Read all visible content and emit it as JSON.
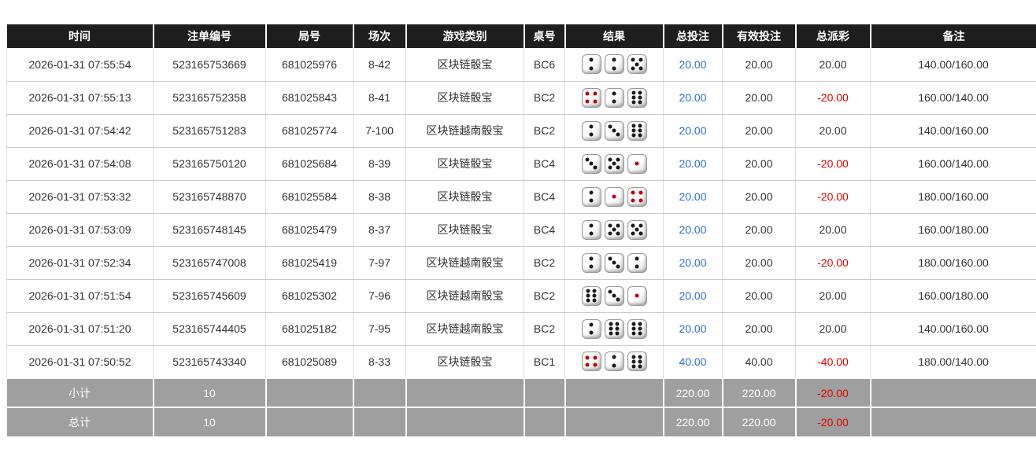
{
  "colors": {
    "header_bg": "#1e1e1e",
    "footer_bg": "#9f9f9f",
    "bet_link_blue": "#2a6ed8",
    "negative_red": "#e00000"
  },
  "table": {
    "headers": [
      "时间",
      "注单编号",
      "局号",
      "场次",
      "游戏类别",
      "桌号",
      "结果",
      "总投注",
      "有效投注",
      "总派彩",
      "备注"
    ],
    "rows": [
      {
        "time": "2026-01-31 07:55:54",
        "bet_id": "523165753669",
        "round_id": "681025976",
        "session": "8-42",
        "game": "区块链骰宝",
        "table_no": "BC6",
        "dice": [
          2,
          2,
          5
        ],
        "total_bet": "20.00",
        "valid_bet": "20.00",
        "payout": "20.00",
        "remark": "140.00/160.00"
      },
      {
        "time": "2026-01-31 07:55:13",
        "bet_id": "523165752358",
        "round_id": "681025843",
        "session": "8-41",
        "game": "区块链骰宝",
        "table_no": "BC2",
        "dice": [
          4,
          2,
          6
        ],
        "total_bet": "20.00",
        "valid_bet": "20.00",
        "payout": "-20.00",
        "remark": "160.00/140.00"
      },
      {
        "time": "2026-01-31 07:54:42",
        "bet_id": "523165751283",
        "round_id": "681025774",
        "session": "7-100",
        "game": "区块链越南骰宝",
        "table_no": "BC2",
        "dice": [
          2,
          3,
          6
        ],
        "total_bet": "20.00",
        "valid_bet": "20.00",
        "payout": "20.00",
        "remark": "140.00/160.00"
      },
      {
        "time": "2026-01-31 07:54:08",
        "bet_id": "523165750120",
        "round_id": "681025684",
        "session": "8-39",
        "game": "区块链骰宝",
        "table_no": "BC4",
        "dice": [
          3,
          5,
          1
        ],
        "total_bet": "20.00",
        "valid_bet": "20.00",
        "payout": "-20.00",
        "remark": "160.00/140.00"
      },
      {
        "time": "2026-01-31 07:53:32",
        "bet_id": "523165748870",
        "round_id": "681025584",
        "session": "8-38",
        "game": "区块链骰宝",
        "table_no": "BC4",
        "dice": [
          2,
          1,
          4
        ],
        "total_bet": "20.00",
        "valid_bet": "20.00",
        "payout": "-20.00",
        "remark": "180.00/160.00"
      },
      {
        "time": "2026-01-31 07:53:09",
        "bet_id": "523165748145",
        "round_id": "681025479",
        "session": "8-37",
        "game": "区块链骰宝",
        "table_no": "BC4",
        "dice": [
          2,
          5,
          5
        ],
        "total_bet": "20.00",
        "valid_bet": "20.00",
        "payout": "20.00",
        "remark": "160.00/180.00"
      },
      {
        "time": "2026-01-31 07:52:34",
        "bet_id": "523165747008",
        "round_id": "681025419",
        "session": "7-97",
        "game": "区块链越南骰宝",
        "table_no": "BC2",
        "dice": [
          2,
          3,
          2
        ],
        "total_bet": "20.00",
        "valid_bet": "20.00",
        "payout": "-20.00",
        "remark": "180.00/160.00"
      },
      {
        "time": "2026-01-31 07:51:54",
        "bet_id": "523165745609",
        "round_id": "681025302",
        "session": "7-96",
        "game": "区块链越南骰宝",
        "table_no": "BC2",
        "dice": [
          6,
          3,
          1
        ],
        "total_bet": "20.00",
        "valid_bet": "20.00",
        "payout": "20.00",
        "remark": "160.00/180.00"
      },
      {
        "time": "2026-01-31 07:51:20",
        "bet_id": "523165744405",
        "round_id": "681025182",
        "session": "7-95",
        "game": "区块链越南骰宝",
        "table_no": "BC2",
        "dice": [
          2,
          6,
          6
        ],
        "total_bet": "20.00",
        "valid_bet": "20.00",
        "payout": "20.00",
        "remark": "140.00/160.00"
      },
      {
        "time": "2026-01-31 07:50:52",
        "bet_id": "523165743340",
        "round_id": "681025089",
        "session": "8-33",
        "game": "区块链骰宝",
        "table_no": "BC1",
        "dice": [
          4,
          2,
          6
        ],
        "total_bet": "40.00",
        "valid_bet": "40.00",
        "payout": "-40.00",
        "remark": "180.00/140.00"
      }
    ],
    "subtotal": {
      "label": "小计",
      "count": "10",
      "total_bet": "220.00",
      "valid_bet": "220.00",
      "payout": "-20.00"
    },
    "total": {
      "label": "总计",
      "count": "10",
      "total_bet": "220.00",
      "valid_bet": "220.00",
      "payout": "-20.00"
    }
  }
}
